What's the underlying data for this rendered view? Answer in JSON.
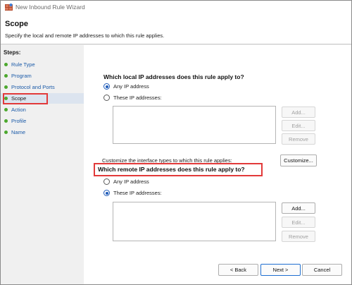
{
  "window": {
    "title": "New Inbound Rule Wizard",
    "icon": "firewall-wizard-icon"
  },
  "header": {
    "title": "Scope",
    "description": "Specify the local and remote IP addresses to which this rule applies."
  },
  "steps": {
    "title": "Steps:",
    "items": [
      {
        "label": "Rule Type",
        "current": false
      },
      {
        "label": "Program",
        "current": false
      },
      {
        "label": "Protocol and Ports",
        "current": false
      },
      {
        "label": "Scope",
        "current": true
      },
      {
        "label": "Action",
        "current": false
      },
      {
        "label": "Profile",
        "current": false
      },
      {
        "label": "Name",
        "current": false
      }
    ]
  },
  "local": {
    "question": "Which local IP addresses does this rule apply to?",
    "option_any": "Any IP address",
    "option_these": "These IP addresses:",
    "selected": "any",
    "buttons": {
      "add": "Add...",
      "edit": "Edit...",
      "remove": "Remove"
    }
  },
  "interface": {
    "text": "Customize the interface types to which this rule applies:",
    "button": "Customize..."
  },
  "remote": {
    "question": "Which remote IP addresses does this rule apply to?",
    "option_any": "Any IP address",
    "option_these": "These IP addresses:",
    "selected": "these",
    "buttons": {
      "add": "Add...",
      "edit": "Edit...",
      "remove": "Remove"
    }
  },
  "nav": {
    "back": "< Back",
    "next": "Next >",
    "cancel": "Cancel"
  },
  "colors": {
    "highlight": "#e23a3a",
    "step_dot": "#4ca82e",
    "link": "#1a5aa8",
    "accent": "#1f5bb8"
  }
}
